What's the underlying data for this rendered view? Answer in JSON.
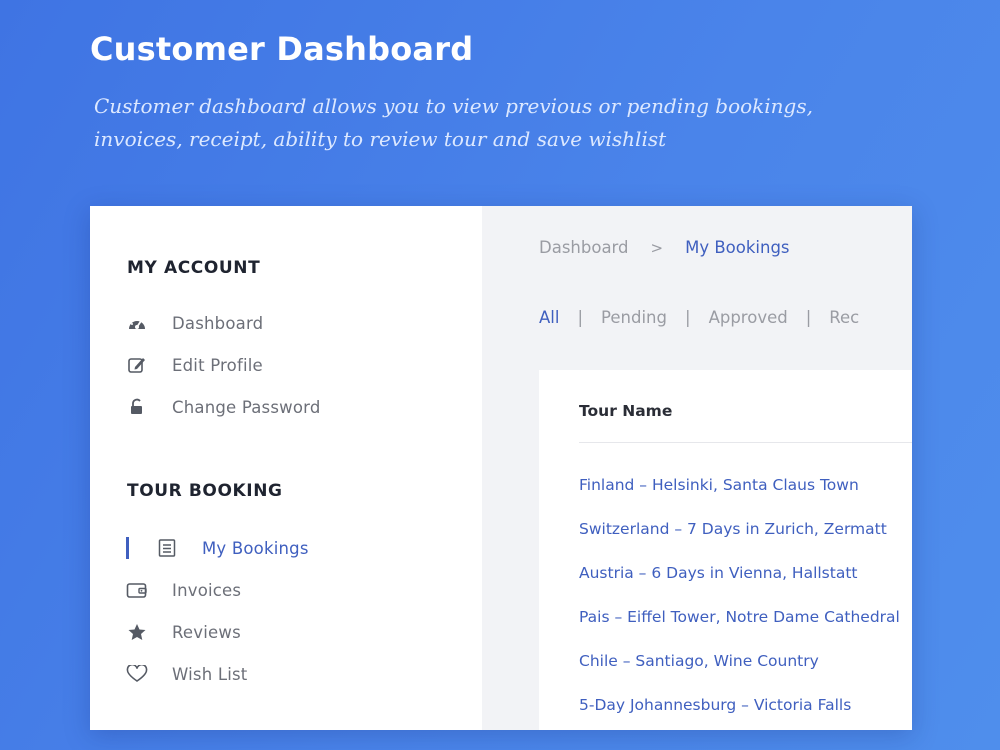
{
  "hero": {
    "title": "Customer Dashboard",
    "subtitle": "Customer dashboard allows you to view previous or pending bookings, invoices, receipt, ability to review tour and save wishlist"
  },
  "sidebar": {
    "account_title": "MY ACCOUNT",
    "account_items": [
      {
        "label": "Dashboard",
        "icon": "dashboard-icon"
      },
      {
        "label": "Edit Profile",
        "icon": "edit-icon"
      },
      {
        "label": "Change Password",
        "icon": "lock-icon"
      }
    ],
    "booking_title": "TOUR BOOKING",
    "booking_items": [
      {
        "label": "My Bookings",
        "icon": "list-icon",
        "active": true
      },
      {
        "label": "Invoices",
        "icon": "wallet-icon"
      },
      {
        "label": "Reviews",
        "icon": "star-icon"
      },
      {
        "label": "Wish List",
        "icon": "heart-icon"
      }
    ]
  },
  "breadcrumb": {
    "root": "Dashboard",
    "separator": ">",
    "current": "My Bookings"
  },
  "filters": {
    "separator": "|",
    "items": [
      "All",
      "Pending",
      "Approved",
      "Rec"
    ]
  },
  "table": {
    "header": "Tour Name",
    "rows": [
      "Finland – Helsinki, Santa Claus Town",
      "Switzerland – 7 Days in Zurich, Zermatt",
      "Austria – 6 Days in Vienna, Hallstatt",
      "Pais – Eiffel Tower, Notre Dame Cathedral",
      "Chile – Santiago, Wine Country",
      "5-Day Johannesburg – Victoria Falls"
    ]
  },
  "colors": {
    "accent": "#3f5fbf",
    "background": "#4a84ea",
    "muted": "#9a9ca3"
  }
}
